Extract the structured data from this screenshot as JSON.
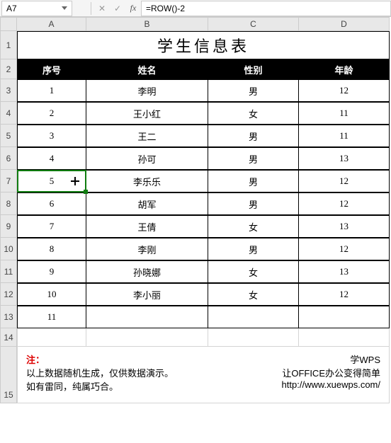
{
  "nameBox": "A7",
  "formula": "=ROW()-2",
  "colHeaders": [
    "A",
    "B",
    "C",
    "D"
  ],
  "rowHeaders": [
    "1",
    "2",
    "3",
    "4",
    "5",
    "6",
    "7",
    "8",
    "9",
    "10",
    "11",
    "12",
    "13",
    "14",
    "15"
  ],
  "title": "学生信息表",
  "tableHeaders": [
    "序号",
    "姓名",
    "性别",
    "年龄"
  ],
  "rows": [
    {
      "n": "1",
      "name": "李明",
      "sex": "男",
      "age": "12"
    },
    {
      "n": "2",
      "name": "王小红",
      "sex": "女",
      "age": "11"
    },
    {
      "n": "3",
      "name": "王二",
      "sex": "男",
      "age": "11"
    },
    {
      "n": "4",
      "name": "孙可",
      "sex": "男",
      "age": "13"
    },
    {
      "n": "5",
      "name": "李乐乐",
      "sex": "男",
      "age": "12"
    },
    {
      "n": "6",
      "name": "胡军",
      "sex": "男",
      "age": "12"
    },
    {
      "n": "7",
      "name": "王倩",
      "sex": "女",
      "age": "13"
    },
    {
      "n": "8",
      "name": "李刚",
      "sex": "男",
      "age": "12"
    },
    {
      "n": "9",
      "name": "孙晓娜",
      "sex": "女",
      "age": "13"
    },
    {
      "n": "10",
      "name": "李小丽",
      "sex": "女",
      "age": "12"
    },
    {
      "n": "11",
      "name": "",
      "sex": "",
      "age": ""
    }
  ],
  "note": {
    "label": "注：",
    "line1": "以上数据随机生成，仅供数据演示。",
    "line2": "如有雷同，纯属巧合。"
  },
  "promo": {
    "l1": "学WPS",
    "l2": "让OFFICE办公变得简单",
    "l3": "http://www.xuewps.com/"
  }
}
